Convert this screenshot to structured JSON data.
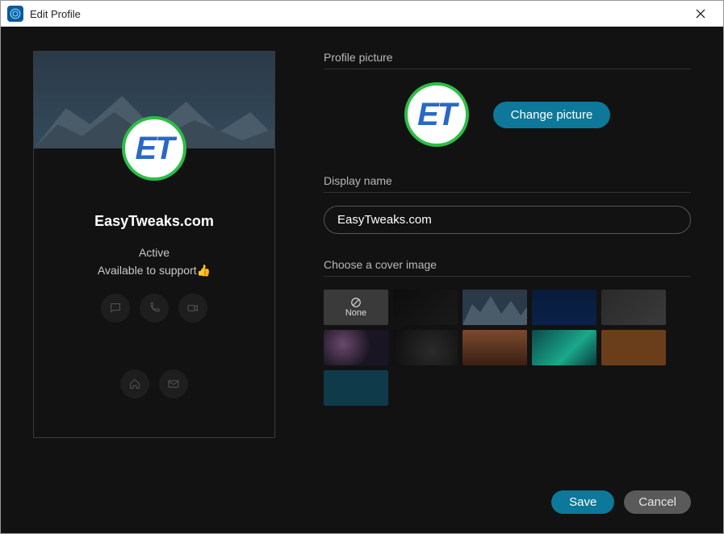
{
  "window": {
    "title": "Edit Profile"
  },
  "profile": {
    "avatar_text": "ET",
    "display_name": "EasyTweaks.com",
    "status": "Active",
    "bio": "Available to support👍",
    "actions": {
      "chat": "chat",
      "call": "call",
      "video": "video",
      "home": "home",
      "mail": "mail"
    }
  },
  "form": {
    "profile_picture_label": "Profile picture",
    "change_picture_label": "Change picture",
    "display_name_label": "Display name",
    "display_name_value": "EasyTweaks.com",
    "cover_label": "Choose a cover image",
    "cover_none_label": "None",
    "covers": [
      {
        "id": "none",
        "label": "None",
        "bg": "#3a3a3a"
      },
      {
        "id": "dark1",
        "label": "",
        "bg": "linear-gradient(135deg,#0d0d0d,#1a1a1a)"
      },
      {
        "id": "mountain",
        "label": "",
        "bg": "linear-gradient(180deg,#2b3a48,#344a5c)"
      },
      {
        "id": "navy",
        "label": "",
        "bg": "linear-gradient(180deg,#081b3a,#0a2148)"
      },
      {
        "id": "grey1",
        "label": "",
        "bg": "linear-gradient(135deg,#2a2a2a,#3a3a3a)"
      },
      {
        "id": "purple",
        "label": "",
        "bg": "radial-gradient(circle at 30% 40%, #6b4a6e 0%, #1a1522 55%)"
      },
      {
        "id": "dark2",
        "label": "",
        "bg": "radial-gradient(circle at 60% 60%,#2a2a2a,#0d0d0d)"
      },
      {
        "id": "desert",
        "label": "",
        "bg": "linear-gradient(180deg,#7a4a2e,#3a1f12)"
      },
      {
        "id": "aurora",
        "label": "",
        "bg": "linear-gradient(135deg,#0a4a4a,#1aa88a 60%, #0a3a3a)"
      },
      {
        "id": "brown",
        "label": "",
        "bg": "#6a3e1a"
      },
      {
        "id": "teal",
        "label": "",
        "bg": "#0f3a4a"
      }
    ]
  },
  "footer": {
    "save_label": "Save",
    "cancel_label": "Cancel"
  }
}
